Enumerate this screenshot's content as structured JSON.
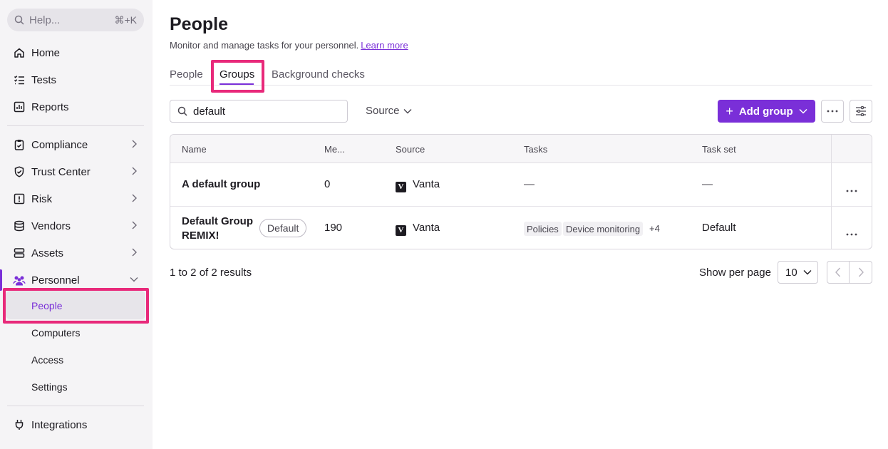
{
  "sidebar": {
    "help": {
      "placeholder": "Help...",
      "shortcut": "⌘+K"
    },
    "items": [
      {
        "label": "Home",
        "icon": "home-icon"
      },
      {
        "label": "Tests",
        "icon": "checklist-icon"
      },
      {
        "label": "Reports",
        "icon": "reports-icon"
      },
      {
        "label": "Compliance",
        "icon": "clipboard-icon"
      },
      {
        "label": "Trust Center",
        "icon": "shield-icon"
      },
      {
        "label": "Risk",
        "icon": "alert-icon"
      },
      {
        "label": "Vendors",
        "icon": "database-icon"
      },
      {
        "label": "Assets",
        "icon": "assets-icon"
      },
      {
        "label": "Personnel",
        "icon": "people-icon"
      },
      {
        "label": "Integrations",
        "icon": "plug-icon"
      }
    ],
    "personnel_sub": [
      "People",
      "Computers",
      "Access",
      "Settings"
    ]
  },
  "page": {
    "title": "People",
    "subtitle": "Monitor and manage tasks for your personnel.",
    "learn_more": "Learn more",
    "tabs": [
      "People",
      "Groups",
      "Background checks"
    ],
    "active_tab": "Groups"
  },
  "toolbar": {
    "search_value": "default",
    "source_filter": "Source",
    "add_group": "Add group"
  },
  "table": {
    "columns": [
      "Name",
      "Me...",
      "Source",
      "Tasks",
      "Task set"
    ],
    "rows": [
      {
        "name": "A default group",
        "members": "0",
        "source": "Vanta",
        "tasks": "—",
        "task_set": "—"
      },
      {
        "name_line1": "Default Group",
        "name_line2": "REMIX!",
        "badge": "Default",
        "members": "190",
        "source": "Vanta",
        "tags": [
          "Policies",
          "Device monitoring"
        ],
        "more_tags": "+4",
        "task_set": "Default"
      }
    ]
  },
  "footer": {
    "results": "1 to 2 of 2 results",
    "per_page_label": "Show per page",
    "per_page_value": "10"
  },
  "colors": {
    "accent": "#7a2fd8",
    "highlight": "#e8297a"
  }
}
